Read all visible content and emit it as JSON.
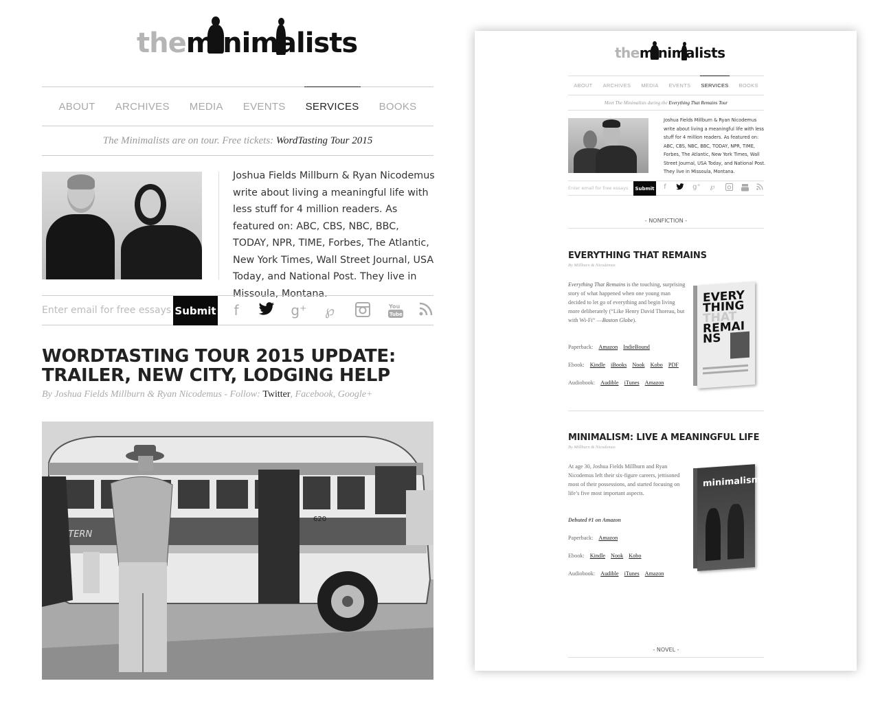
{
  "left": {
    "logo": {
      "the": "the",
      "word": "minimalists"
    },
    "nav": [
      "ABOUT",
      "ARCHIVES",
      "MEDIA",
      "EVENTS",
      "SERVICES",
      "BOOKS"
    ],
    "tour": {
      "prefix": "The Minimalists are on tour. Free tickets:",
      "link": "WordTasting Tour 2015"
    },
    "bio": "Joshua Fields Millburn & Ryan Nicodemus write about living a meaningful life with less stuff for 4 million readers. As featured on: ABC, CBS, NBC, BBC, TODAY, NPR, TIME, Forbes, The Atlantic, New York Times, Wall Street Journal, USA Today, and National Post. They live in Missoula, Montana.",
    "subscribe": {
      "placeholder": "Enter email for free essays",
      "button": "Submit"
    },
    "social": [
      "facebook-icon",
      "twitter-icon",
      "google-plus-icon",
      "pinterest-icon",
      "instagram-icon",
      "youtube-icon",
      "rss-icon"
    ],
    "post": {
      "title": "WORDTASTING TOUR 2015 UPDATE: TRAILER, NEW CITY, LODGING HELP",
      "byline_prefix": "By Joshua Fields Millburn & Ryan Nicodemus - Follow:",
      "byline_links": [
        "Twitter",
        "Facebook",
        "Google+"
      ]
    }
  },
  "right": {
    "logo": {
      "the": "the",
      "word": "minimalists"
    },
    "nav": [
      "ABOUT",
      "ARCHIVES",
      "MEDIA",
      "EVENTS",
      "SERVICES",
      "BOOKS"
    ],
    "tour": {
      "prefix": "Meet The Minimalists during the",
      "link": "Everything That Remains Tour"
    },
    "bio": "Joshua Fields Millburn & Ryan Nicodemus write about living a meaningful life with less stuff for 4 million readers. As featured on: ABC, CBS, NBC, BBC, TODAY, NPR, TIME, Forbes, The Atlantic, New York Times, Wall Street Journal, USA Today, and National Post. They live in Missoula, Montana.",
    "subscribe": {
      "placeholder": "Enter email for free essays",
      "button": "Submit"
    },
    "sections": {
      "nonfiction": "- NONFICTION -",
      "novel": "- NOVEL -"
    },
    "books": [
      {
        "title": "EVERYTHING THAT REMAINS",
        "by": "By Millburn & Nicodemus",
        "desc_em": "Everything That Remains",
        "desc": " is the touching, surprising story of what happened when one young man decided to let go of everything and begin living more deliberately (“Like Henry David Thoreau, but with Wi-Fi” —",
        "desc_src": "Boston Globe",
        "desc_end": ").",
        "paperback_label": "Paperback:",
        "paperback": [
          "Amazon",
          "IndieBound"
        ],
        "ebook_label": "Ebook:",
        "ebook": [
          "Kindle",
          "iBooks",
          "Nook",
          "Kobo",
          "PDF"
        ],
        "audiobook_label": "Audiobook:",
        "audiobook": [
          "Audible",
          "iTunes",
          "Amazon"
        ],
        "cover_text": [
          "EVERY",
          "THING",
          "THAT",
          "REMAI",
          "NS"
        ]
      },
      {
        "title": "MINIMALISM: LIVE A MEANINGFUL LIFE",
        "by": "By Millburn & Nicodemus",
        "desc": "At age 30, Joshua Fields Millburn and Ryan Nicodemus left their six-figure careers, jettisoned most of their possessions, and started focusing on life’s five most important aspects.",
        "debut": "Debuted #1 on Amazon",
        "paperback_label": "Paperback:",
        "paperback": [
          "Amazon"
        ],
        "ebook_label": "Ebook:",
        "ebook": [
          "Kindle",
          "Nook",
          "Kobo"
        ],
        "audiobook_label": "Audiobook:",
        "audiobook": [
          "Audible",
          "iTunes",
          "Amazon"
        ],
        "cover_text": [
          "minimalism"
        ]
      }
    ]
  }
}
